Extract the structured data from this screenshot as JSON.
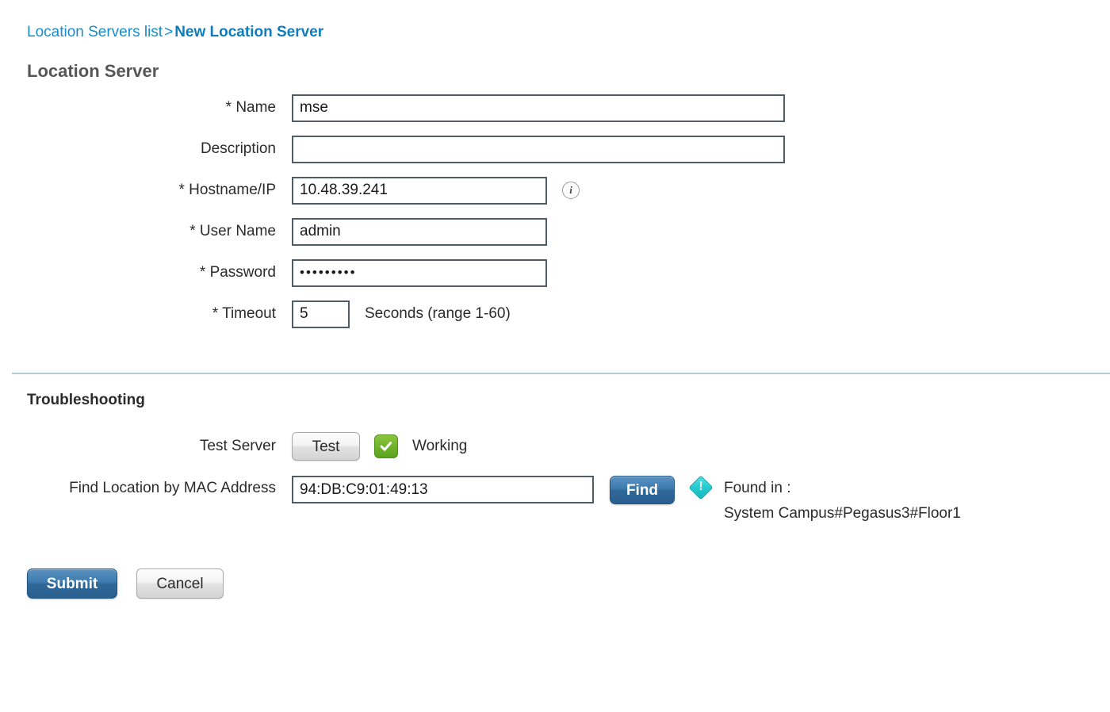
{
  "breadcrumb": {
    "parent": "Location Servers list",
    "separator": ">",
    "current": "New Location Server"
  },
  "page_title": "Location Server",
  "form": {
    "fields": [
      {
        "label": "* Name",
        "name": "name",
        "value": "mse",
        "placeholder": "",
        "hint": "",
        "has_info_icon": false
      },
      {
        "label": "Description",
        "name": "description",
        "value": "",
        "placeholder": "",
        "hint": "",
        "has_info_icon": false
      },
      {
        "label": "* Hostname/IP",
        "name": "hostname-ip",
        "value": "10.48.39.241",
        "placeholder": "",
        "hint": "",
        "has_info_icon": true
      },
      {
        "label": "* User Name",
        "name": "user-name",
        "value": "admin",
        "placeholder": "",
        "hint": "",
        "has_info_icon": false
      },
      {
        "label": "* Password",
        "name": "password",
        "value": "•••••••••",
        "placeholder": "",
        "hint": "",
        "has_info_icon": false
      },
      {
        "label": "* Timeout",
        "name": "timeout",
        "value": "5",
        "placeholder": "",
        "hint": "Seconds (range 1-60)",
        "has_info_icon": false
      }
    ]
  },
  "troubleshooting": {
    "title": "Troubleshooting",
    "test_server": {
      "label": "Test Server",
      "button_label": "Test",
      "status_icon": "green-check-icon",
      "status_text": "Working"
    },
    "find_location": {
      "label": "Find Location by MAC Address",
      "mac_value": "94:DB:C9:01:49:13",
      "mac_placeholder": "",
      "button_label": "Find",
      "result_icon": "cyan-info-diamond-icon",
      "result_line1": "Found in :",
      "result_line2": "System Campus#Pegasus3#Floor1"
    }
  },
  "footer": {
    "submit_label": "Submit",
    "cancel_label": "Cancel"
  },
  "colors": {
    "breadcrumb_link": "#1a8cc8",
    "breadcrumb_current": "#0f7cbb",
    "page_title": "#565656",
    "input_border": "#4d5d63",
    "divider": "#b4ccd8",
    "primary_button": "#2f6899",
    "status_ok": "#6fb22a",
    "info_badge": "#22c9cf"
  }
}
